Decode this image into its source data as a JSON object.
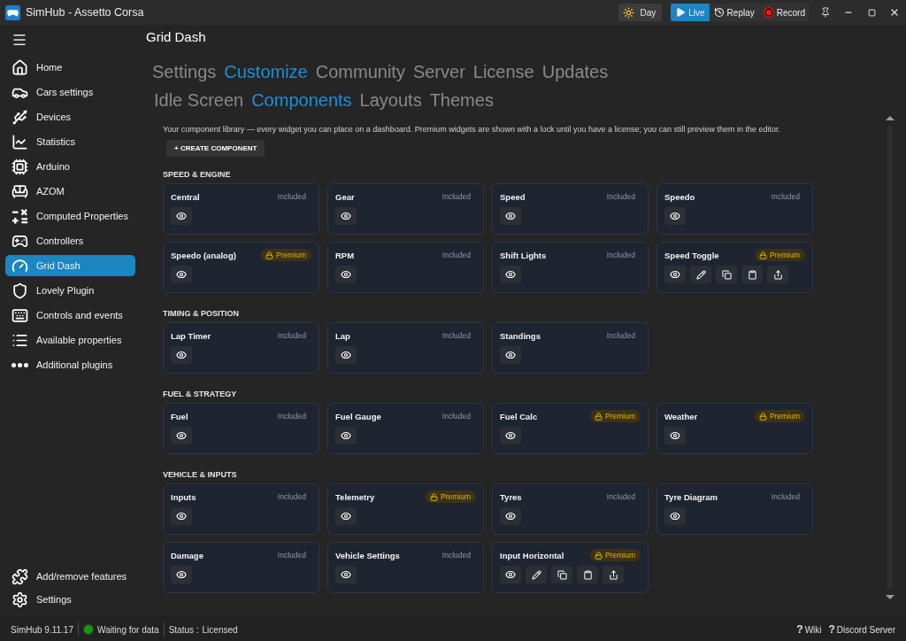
{
  "window": {
    "title": "SimHub - Assetto Corsa"
  },
  "title_bar": {
    "theme_toggle": {
      "label": "Day"
    },
    "modes": [
      {
        "kind": "live",
        "label": "Live",
        "selected": true
      },
      {
        "kind": "replay",
        "label": "Replay",
        "selected": false
      },
      {
        "kind": "record",
        "label": "Record",
        "selected": false
      }
    ]
  },
  "sidebar": {
    "items": [
      {
        "label": "Home",
        "selected": false
      },
      {
        "label": "Cars settings",
        "selected": false
      },
      {
        "label": "Devices",
        "selected": false
      },
      {
        "label": "Statistics",
        "selected": false
      },
      {
        "label": "Arduino",
        "selected": false
      },
      {
        "label": "AZOM",
        "selected": false
      },
      {
        "label": "Computed Properties",
        "selected": false
      },
      {
        "label": "Controllers",
        "selected": false
      },
      {
        "label": "Grid Dash",
        "selected": true
      },
      {
        "label": "Lovely Plugin",
        "selected": false
      },
      {
        "label": "Controls and events",
        "selected": false
      },
      {
        "label": "Available properties",
        "selected": false
      },
      {
        "label": "Additional plugins",
        "selected": false
      }
    ],
    "footer_items": [
      {
        "label": "Add/remove features",
        "selected": false
      },
      {
        "label": "Settings",
        "selected": false
      }
    ]
  },
  "page": {
    "title": "Grid Dash",
    "tabs": [
      {
        "label": "Settings",
        "selected": false
      },
      {
        "label": "Customize",
        "selected": true
      },
      {
        "label": "Community",
        "selected": false
      },
      {
        "label": "Server",
        "selected": false
      },
      {
        "label": "License",
        "selected": false
      },
      {
        "label": "Updates",
        "selected": false
      }
    ],
    "subtabs": [
      {
        "label": "Idle Screen",
        "selected": false
      },
      {
        "label": "Components",
        "selected": true
      },
      {
        "label": "Layouts",
        "selected": false
      },
      {
        "label": "Themes",
        "selected": false
      }
    ],
    "description": "Your component library — every widget you can place on a dashboard. Premium widgets are shown with a lock until you have a license; you can still preview them in the editor.",
    "create_button": {
      "label": "+ CREATE COMPONENT"
    },
    "sections": [
      {
        "title": "SPEED & ENGINE",
        "components": [
          {
            "name": "Central",
            "badge": "Included",
            "premium": false,
            "editable": false
          },
          {
            "name": "Gear",
            "badge": "Included",
            "premium": false,
            "editable": false
          },
          {
            "name": "Speed",
            "badge": "Included",
            "premium": false,
            "editable": false
          },
          {
            "name": "Speedo",
            "badge": "Included",
            "premium": false,
            "editable": false
          },
          {
            "name": "Speedo (analog)",
            "badge": "Premium",
            "premium": true,
            "editable": false
          },
          {
            "name": "RPM",
            "badge": "Included",
            "premium": false,
            "editable": false
          },
          {
            "name": "Shift Lights",
            "badge": "Included",
            "premium": false,
            "editable": false
          },
          {
            "name": "Speed Toggle",
            "badge": "Premium",
            "premium": true,
            "editable": true
          }
        ]
      },
      {
        "title": "TIMING & POSITION",
        "components": [
          {
            "name": "Lap Timer",
            "badge": "Included",
            "premium": false,
            "editable": false
          },
          {
            "name": "Lap",
            "badge": "Included",
            "premium": false,
            "editable": false
          },
          {
            "name": "Standings",
            "badge": "Included",
            "premium": false,
            "editable": false
          }
        ]
      },
      {
        "title": "FUEL & STRATEGY",
        "components": [
          {
            "name": "Fuel",
            "badge": "Included",
            "premium": false,
            "editable": false
          },
          {
            "name": "Fuel Gauge",
            "badge": "Included",
            "premium": false,
            "editable": false
          },
          {
            "name": "Fuel Calc",
            "badge": "Premium",
            "premium": true,
            "editable": false
          },
          {
            "name": "Weather",
            "badge": "Premium",
            "premium": true,
            "editable": false
          }
        ]
      },
      {
        "title": "VEHICLE & INPUTS",
        "components": [
          {
            "name": "Inputs",
            "badge": "Included",
            "premium": false,
            "editable": false
          },
          {
            "name": "Telemetry",
            "badge": "Premium",
            "premium": true,
            "editable": false
          },
          {
            "name": "Tyres",
            "badge": "Included",
            "premium": false,
            "editable": false
          },
          {
            "name": "Tyre Diagram",
            "badge": "Included",
            "premium": false,
            "editable": false
          },
          {
            "name": "Damage",
            "badge": "Included",
            "premium": false,
            "editable": false
          },
          {
            "name": "Vehicle Settings",
            "badge": "Included",
            "premium": false,
            "editable": false
          },
          {
            "name": "Input Horizontal",
            "badge": "Premium",
            "premium": true,
            "editable": true
          }
        ]
      }
    ]
  },
  "status_bar": {
    "version": "SimHub 9.11.17",
    "connection": {
      "label": "Waiting for data",
      "on": true
    },
    "status": {
      "label": "Status :",
      "value": "Licensed"
    },
    "links": [
      {
        "glyph": "?",
        "label": "Wiki"
      },
      {
        "glyph": "?",
        "label": "Discord Server"
      }
    ]
  }
}
